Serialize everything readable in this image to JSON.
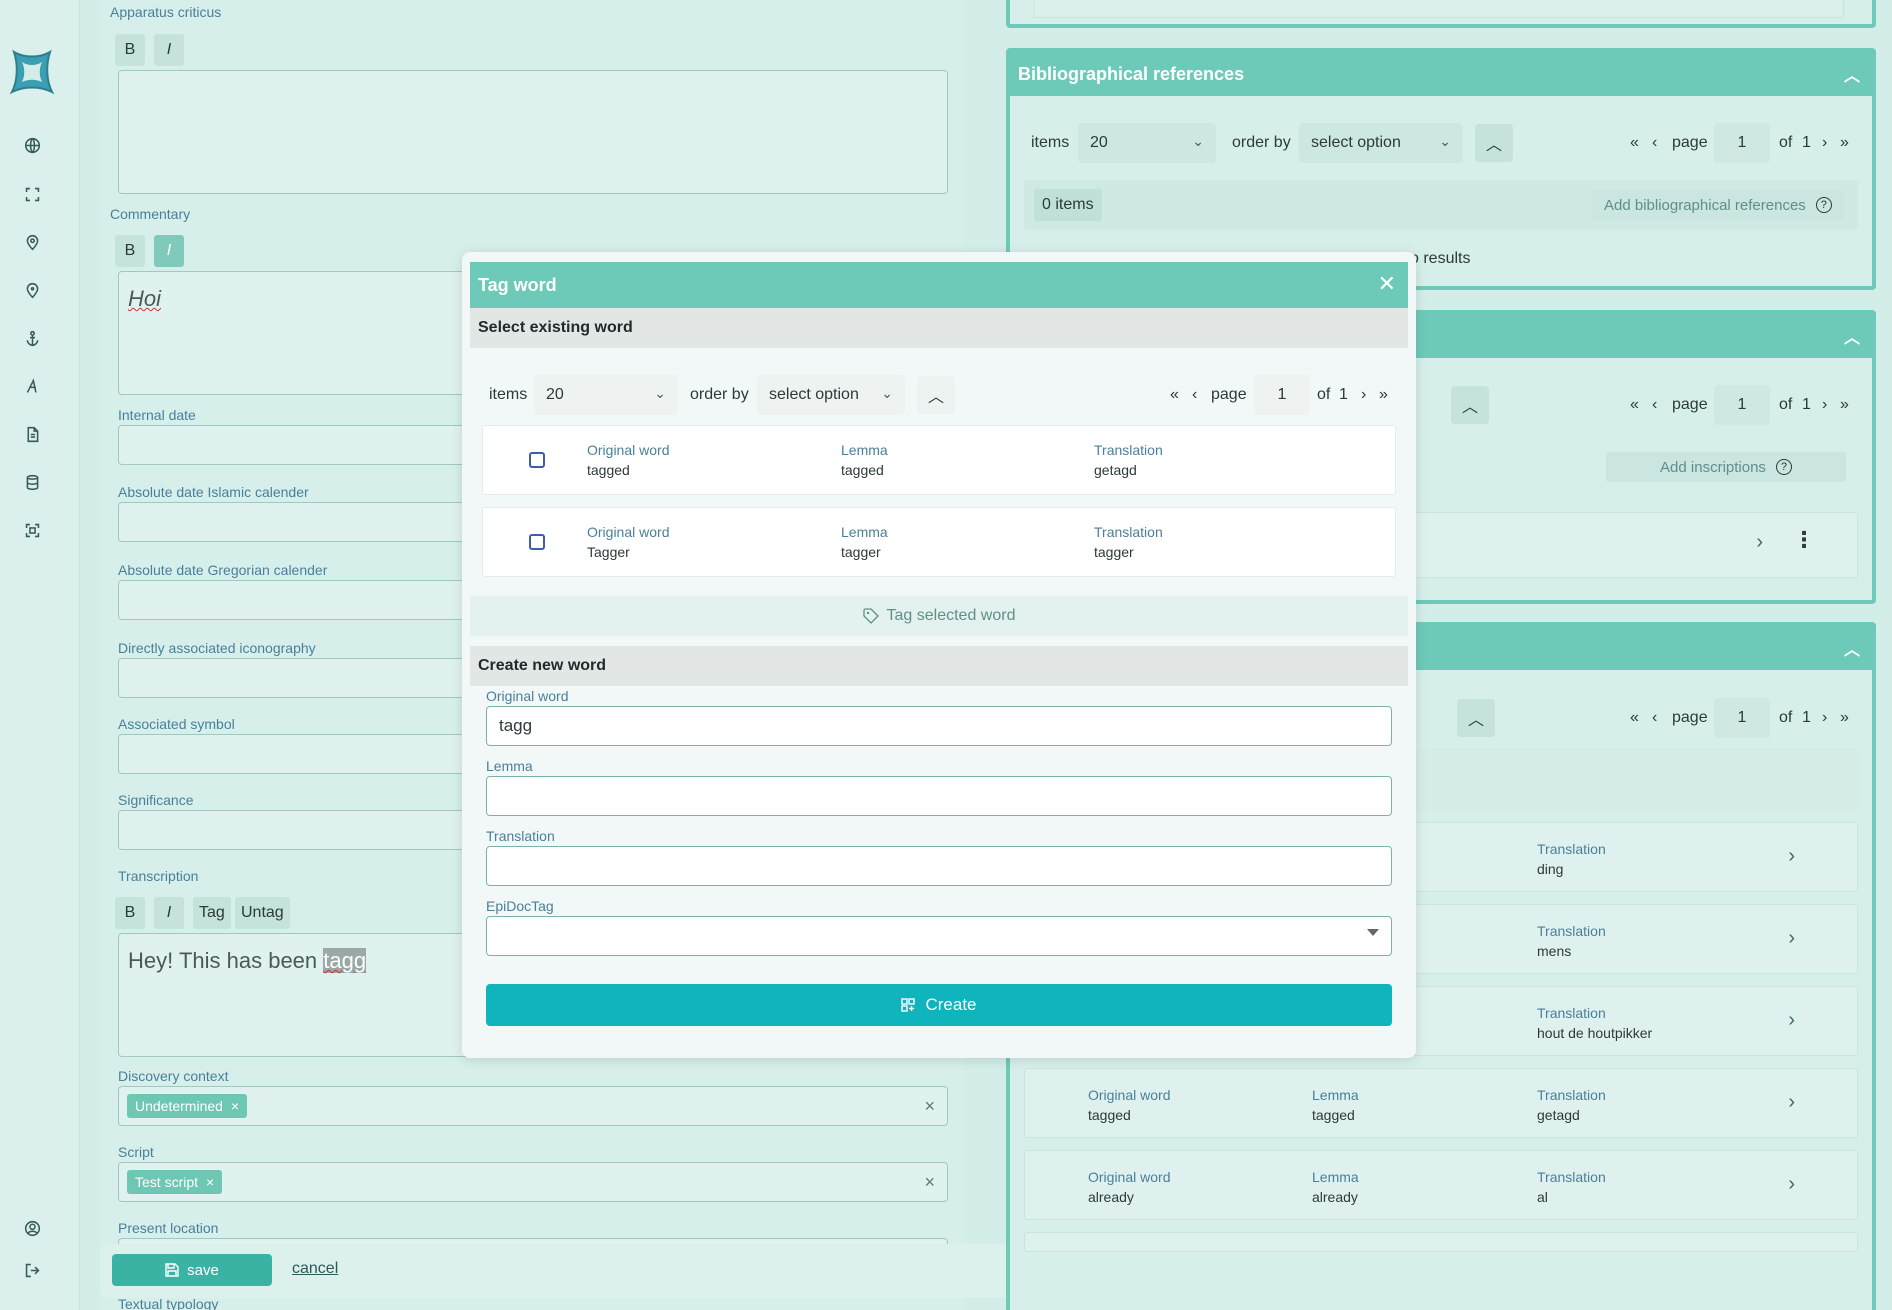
{
  "sidebar": {
    "icons": [
      "globe-icon",
      "expand-icon",
      "location-pin-icon",
      "map-marker-icon",
      "anchor-icon",
      "script-letter-icon",
      "document-icon",
      "database-icon",
      "fullscreen-icon",
      "user-circle-icon",
      "logout-icon"
    ]
  },
  "form": {
    "apparatus_label": "Apparatus criticus",
    "commentary_label": "Commentary",
    "commentary_text": "Hoi",
    "internal_date_label": "Internal date",
    "islamic_label": "Absolute date Islamic calender",
    "gregorian_label": "Absolute date Gregorian calender",
    "iconography_label": "Directly associated iconography",
    "symbol_label": "Associated symbol",
    "significance_label": "Significance",
    "transcription_label": "Transcription",
    "transcription_text": "Hey! This has been ",
    "transcription_tagged": "tagg",
    "discovery_label": "Discovery context",
    "discovery_chip": "Undetermined",
    "script_label": "Script",
    "script_chip": "Test script",
    "present_location_label": "Present location",
    "textual_typology_label": "Textual typology",
    "btn_bold": "B",
    "btn_italic": "I",
    "btn_tag": "Tag",
    "btn_untag": "Untag",
    "chip_remove": "×",
    "clear": "×"
  },
  "actions": {
    "save": "save",
    "cancel": "cancel"
  },
  "right": {
    "biblio_title": "Bibliographical references",
    "items_label": "items",
    "items_value": "20",
    "order_by_label": "order by",
    "order_by_value": "select option",
    "page_label": "page",
    "page_value": "1",
    "of_label": "of",
    "total_pages": "1",
    "zero_items": "0 items",
    "add_biblio": "Add bibliographical references",
    "no_results": "o results",
    "add_inscriptions": "Add inscriptions",
    "words": [
      {
        "orig_label": "",
        "orig": "",
        "lemma_label": "",
        "lemma": "",
        "trans_label": "Translation",
        "trans": "ding"
      },
      {
        "orig_label": "",
        "orig": "",
        "lemma_label": "",
        "lemma": "",
        "trans_label": "Translation",
        "trans": "mens"
      },
      {
        "orig_label": "",
        "orig": "",
        "lemma_label": "",
        "lemma": "",
        "trans_label": "Translation",
        "trans": "hout de houtpikker"
      },
      {
        "orig_label": "Original word",
        "orig": "tagged",
        "lemma_label": "Lemma",
        "lemma": "tagged",
        "trans_label": "Translation",
        "trans": "getagd"
      },
      {
        "orig_label": "Original word",
        "orig": "already",
        "lemma_label": "Lemma",
        "lemma": "already",
        "trans_label": "Translation",
        "trans": "al"
      }
    ]
  },
  "modal": {
    "title": "Tag word",
    "select_existing": "Select existing word",
    "items_label": "items",
    "items_value": "20",
    "order_by_label": "order by",
    "order_by_value": "select option",
    "page_label": "page",
    "page_value": "1",
    "of_label": "of",
    "total_pages": "1",
    "words": [
      {
        "orig_label": "Original word",
        "orig": "tagged",
        "lemma_label": "Lemma",
        "lemma": "tagged",
        "trans_label": "Translation",
        "trans": "getagd"
      },
      {
        "orig_label": "Original word",
        "orig": "Tagger",
        "lemma_label": "Lemma",
        "lemma": "tagger",
        "trans_label": "Translation",
        "trans": "tagger"
      }
    ],
    "tag_selected": "Tag selected word",
    "create_new": "Create new word",
    "orig_label": "Original word",
    "orig_value": "tagg",
    "lemma_label": "Lemma",
    "lemma_value": "",
    "translation_label": "Translation",
    "translation_value": "",
    "epidoc_label": "EpiDocTag",
    "epidoc_value": "",
    "create": "Create"
  },
  "pager_glyphs": {
    "first": "«",
    "prev": "‹",
    "next": "›",
    "last": "»"
  },
  "colors": {
    "accent": "#6ecab8",
    "create": "#0fb4bd",
    "label": "#4a7f9a"
  }
}
